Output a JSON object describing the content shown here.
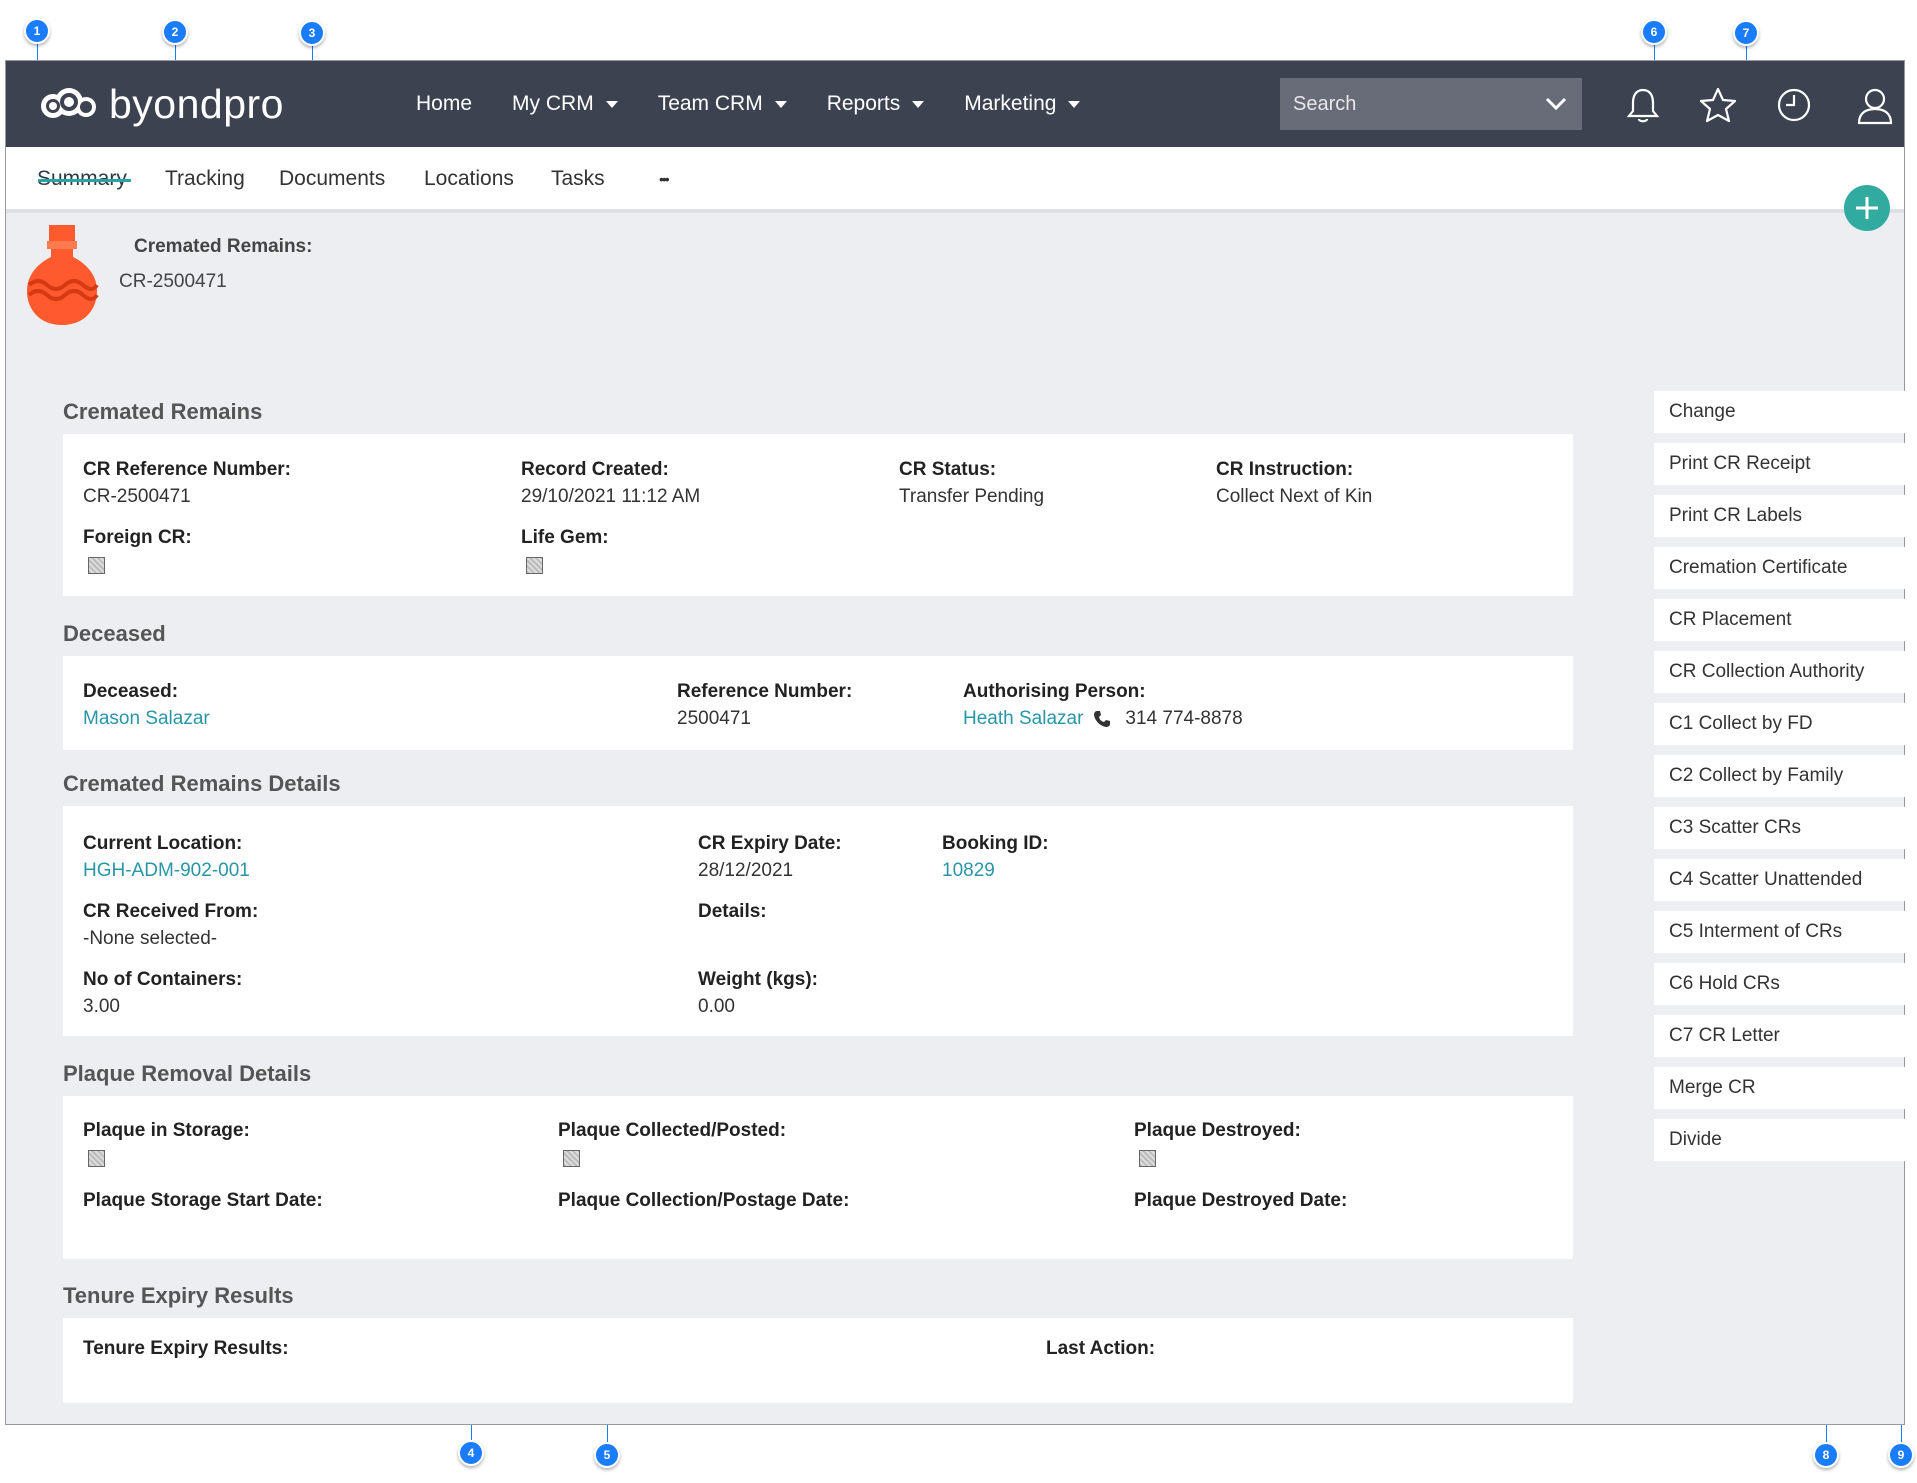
{
  "brand": {
    "name": "byondpro"
  },
  "nav": {
    "items": [
      {
        "label": "Home",
        "dropdown": false
      },
      {
        "label": "My CRM",
        "dropdown": true
      },
      {
        "label": "Team CRM",
        "dropdown": true
      },
      {
        "label": "Reports",
        "dropdown": true
      },
      {
        "label": "Marketing",
        "dropdown": true
      }
    ],
    "search_placeholder": "Search"
  },
  "toolbar_icons": [
    "bell-icon",
    "star-icon",
    "clock-icon",
    "user-icon"
  ],
  "tabs": [
    "Summary",
    "Tracking",
    "Documents",
    "Locations",
    "Tasks",
    "•••"
  ],
  "record": {
    "title": "Cremated Remains:",
    "number": "CR-2500471"
  },
  "sections": {
    "cremated_remains": {
      "title": "Cremated Remains",
      "cr_ref_label": "CR Reference Number:",
      "cr_ref_value": "CR-2500471",
      "record_created_label": "Record Created:",
      "record_created_value": "29/10/2021 11:12 AM",
      "cr_status_label": "CR Status:",
      "cr_status_value": "Transfer Pending",
      "cr_instruction_label": "CR Instruction:",
      "cr_instruction_value": "Collect Next of Kin",
      "foreign_cr_label": "Foreign CR:",
      "life_gem_label": "Life Gem:"
    },
    "deceased": {
      "title": "Deceased",
      "deceased_label": "Deceased:",
      "deceased_value": "Mason Salazar",
      "reference_label": "Reference Number:",
      "reference_value": "2500471",
      "authorising_label": "Authorising Person:",
      "authorising_value": "Heath Salazar",
      "phone": "314 774-8878"
    },
    "details": {
      "title": "Cremated Remains Details",
      "current_location_label": "Current Location:",
      "current_location_value": "HGH-ADM-902-001",
      "expiry_label": "CR Expiry Date:",
      "expiry_value": "28/12/2021",
      "booking_label": "Booking ID:",
      "booking_value": "10829",
      "received_label": "CR Received From:",
      "received_value": "-None selected-",
      "details_label": "Details:",
      "containers_label": "No of Containers:",
      "containers_value": "3.00",
      "weight_label": "Weight (kgs):",
      "weight_value": "0.00"
    },
    "plaque": {
      "title": "Plaque Removal Details",
      "storage_label": "Plaque in Storage:",
      "collected_label": "Plaque Collected/Posted:",
      "destroyed_label": "Plaque Destroyed:",
      "storage_date_label": "Plaque Storage Start Date:",
      "collection_date_label": "Plaque Collection/Postage Date:",
      "destroyed_date_label": "Plaque Destroyed Date:"
    },
    "tenure": {
      "title": "Tenure Expiry Results",
      "results_label": "Tenure Expiry Results:",
      "last_action_label": "Last Action:"
    }
  },
  "actions": [
    "Change",
    "Print CR Receipt",
    "Print CR Labels",
    "Cremation Certificate",
    "CR Placement",
    "CR Collection Authority",
    "C1 Collect by FD",
    "C2 Collect by Family",
    "C3 Scatter CRs",
    "C4 Scatter Unattended",
    "C5 Interment of CRs",
    "C6 Hold CRs",
    "C7 CR Letter",
    "Merge CR",
    "Divide"
  ],
  "callouts": [
    "1",
    "2",
    "3",
    "4",
    "5",
    "6",
    "7",
    "8",
    "9"
  ],
  "colors": {
    "topbar": "#3c4250",
    "accent": "#2aa3a3",
    "link": "#2996a6",
    "callout": "#1a7cff",
    "urn": "#ff5a2e"
  }
}
